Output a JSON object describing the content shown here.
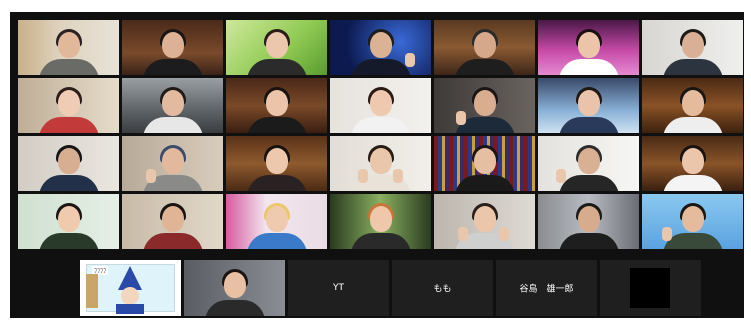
{
  "meeting": {
    "name_tiles": [
      {
        "label": "YT"
      },
      {
        "label": "もも"
      },
      {
        "label": "谷島　雄一郎"
      }
    ],
    "illustration_caption": "ﾌﾌﾌﾌ",
    "active_speaker_index": 1
  },
  "colors": {
    "background": "#101010",
    "active_border": "#d8e64a",
    "name_tile": "#1f1f1f"
  }
}
